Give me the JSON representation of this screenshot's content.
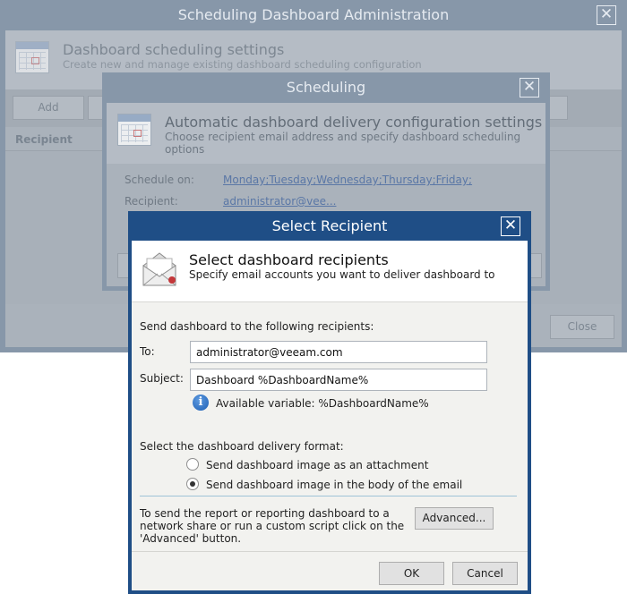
{
  "back_window": {
    "title": "Scheduling Dashboard Administration",
    "header_title": "Dashboard scheduling settings",
    "header_subtitle": "Create new and manage existing dashboard scheduling configuration",
    "add_label": "Add",
    "column_recipient": "Recipient",
    "close_label": "Close"
  },
  "middle_window": {
    "title": "Scheduling",
    "header_title": "Automatic dashboard delivery configuration settings",
    "header_subtitle": "Choose recipient email address and specify dashboard scheduling options",
    "schedule_label": "Schedule on:",
    "schedule_value": "Monday;Tuesday;Wednesday;Thursday;Friday;",
    "recipient_label": "Recipient:",
    "recipient_value": "administrator@vee..."
  },
  "dialog": {
    "title": "Select Recipient",
    "header_title": "Select dashboard recipients",
    "header_subtitle": "Specify email accounts you want to deliver dashboard to",
    "send_to_label": "Send dashboard to the following recipients:",
    "to_label": "To:",
    "to_value": "administrator@veeam.com",
    "subject_label": "Subject:",
    "subject_value": "Dashboard %DashboardName%",
    "available_variable": "Available variable: %DashboardName%",
    "format_label": "Select the dashboard delivery format:",
    "option_attachment": "Send dashboard image as an attachment",
    "option_body": "Send dashboard image in the body of the email",
    "selected_option": "body",
    "advanced_text_1": "To send the report or reporting dashboard to a",
    "advanced_text_2": "network share or run a custom script click on the",
    "advanced_text_3": "'Advanced' button.",
    "advanced_label": "Advanced...",
    "ok_label": "OK",
    "cancel_label": "Cancel"
  },
  "icons": {
    "close": "close-icon",
    "calendar": "calendar-icon",
    "envelope": "envelope-icon",
    "info": "info-icon"
  }
}
